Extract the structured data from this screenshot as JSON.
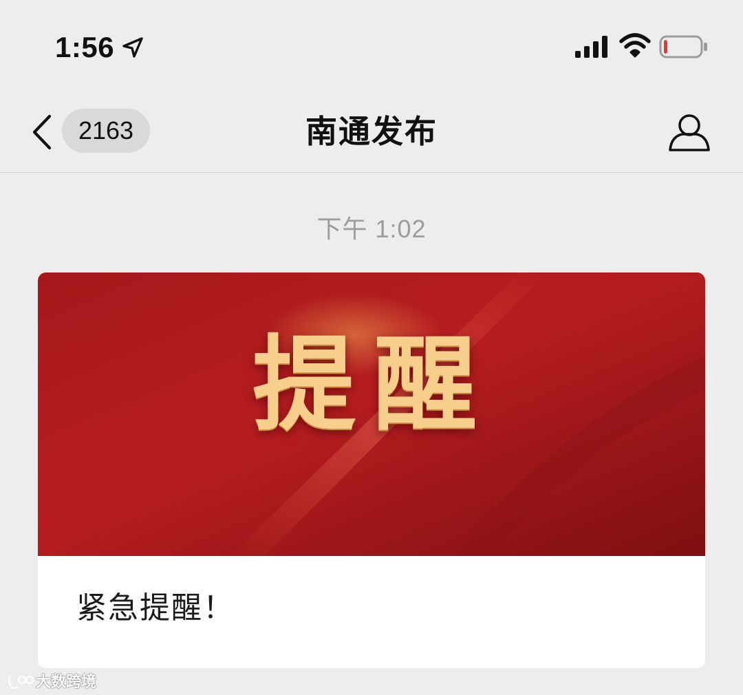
{
  "status_bar": {
    "time": "1:56",
    "icons": [
      "location-arrow-icon",
      "cellular-signal-icon",
      "wifi-icon",
      "battery-low-icon"
    ],
    "battery_level_fraction": 0.1,
    "battery_color": "#e53935"
  },
  "nav_bar": {
    "back_icon": "chevron-left-icon",
    "unread_count": "2163",
    "title": "南通发布",
    "profile_icon": "person-icon"
  },
  "chat": {
    "timestamp": "下午 1:02",
    "article": {
      "cover_text": [
        "提",
        "醒"
      ],
      "title": "紧急提醒！",
      "cover_colors": {
        "background": "#a3171a",
        "text": "#f6cf8c"
      }
    }
  },
  "watermark": {
    "text": "大数跨境"
  }
}
